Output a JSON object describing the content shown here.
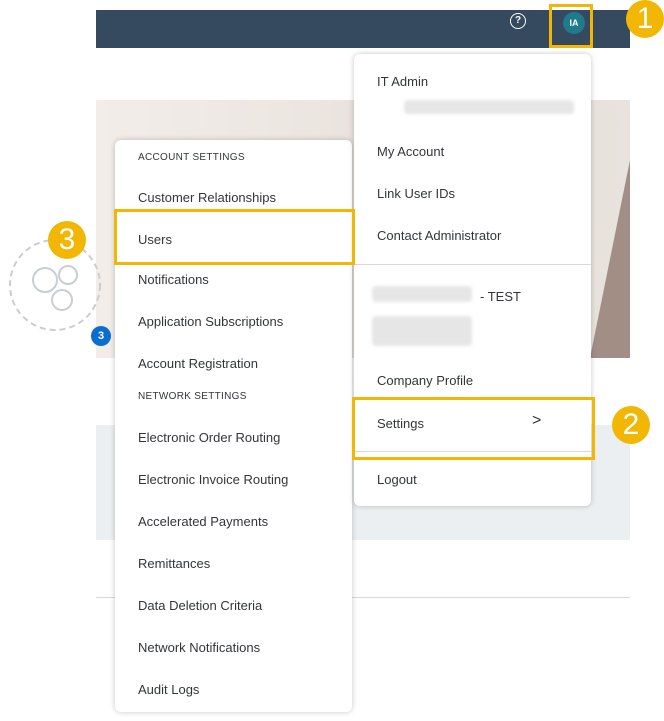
{
  "header": {
    "help_icon": "?",
    "avatar_initials": "IA"
  },
  "user_menu": {
    "name": "IT Admin",
    "items": [
      "My Account",
      "Link User IDs",
      "Contact Administrator"
    ],
    "company_suffix": "- TEST",
    "company_items": [
      "Company Profile",
      "Settings",
      "Logout"
    ]
  },
  "settings_menu": {
    "account_heading": "ACCOUNT SETTINGS",
    "account_items": [
      "Customer Relationships",
      "Users",
      "Notifications",
      "Application Subscriptions",
      "Account Registration"
    ],
    "network_heading": "NETWORK SETTINGS",
    "network_items": [
      "Electronic Order Routing",
      "Electronic Invoice Routing",
      "Accelerated Payments",
      "Remittances",
      "Data Deletion Criteria",
      "Network Notifications",
      "Audit Logs"
    ]
  },
  "background": {
    "count_badge": "3"
  },
  "callouts": {
    "step1": "1",
    "step2": "2",
    "step3": "3",
    "color": "#f2b705"
  }
}
